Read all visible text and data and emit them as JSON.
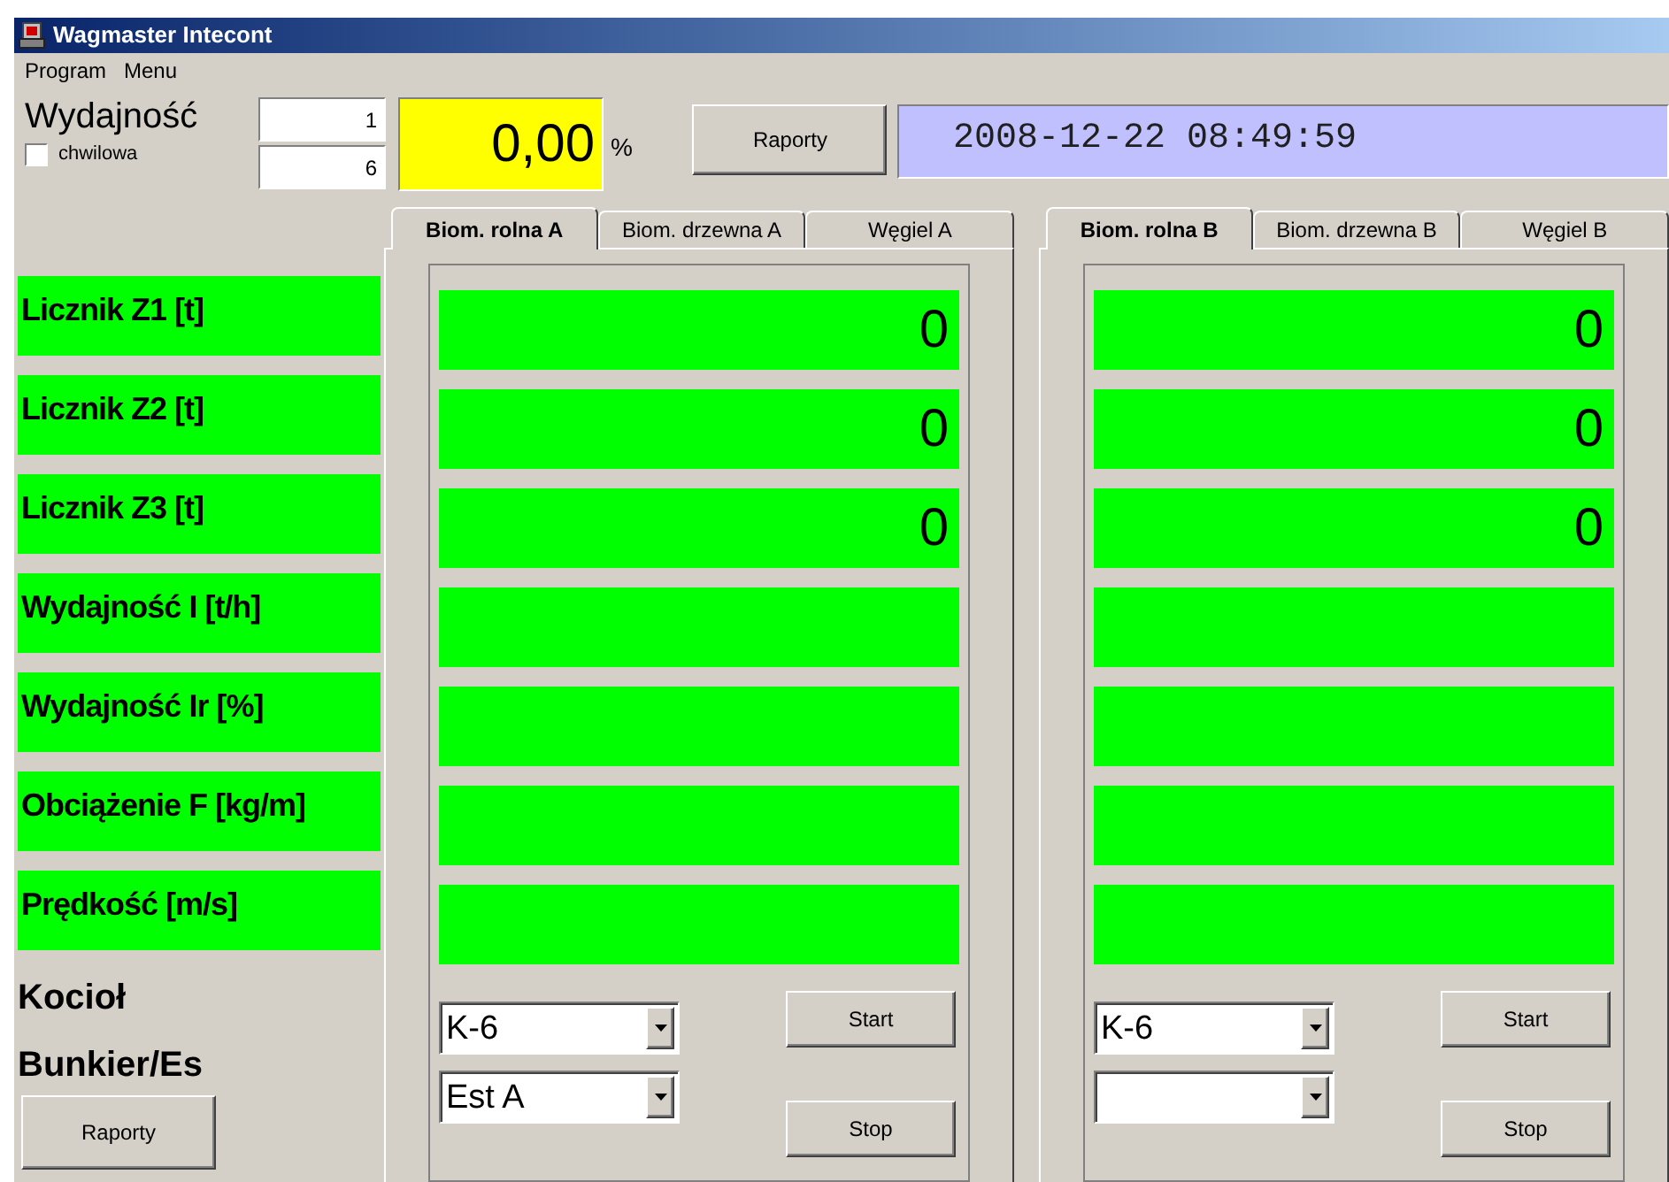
{
  "window": {
    "title": "Wagmaster Intecont"
  },
  "menu": [
    "Program",
    "Menu"
  ],
  "header": {
    "label": "Wydajność",
    "checkbox": {
      "label": "chwilowa",
      "checked": false
    },
    "fields": [
      "1",
      "6"
    ],
    "percent": "0,00",
    "unit": "%",
    "button": "Raporty",
    "datetime": "2008-12-22 08:49:59"
  },
  "rows": [
    "Licznik Z1 [t]",
    "Licznik Z2 [t]",
    "Licznik Z3 [t]",
    "Wydajność I [t/h]",
    "Wydajność Ir [%]",
    "Obciążenie F [kg/m]",
    "Prędkość [m/s]"
  ],
  "footer": {
    "kociol": "Kocioł",
    "bunkier": "Bunkier/Es",
    "button": "Raporty"
  },
  "panels": [
    {
      "tabs": [
        {
          "label": "Biom. rolna A",
          "selected": true
        },
        {
          "label": "Biom. drzewna A",
          "selected": false
        },
        {
          "label": "Węgiel A",
          "selected": false
        }
      ],
      "values": [
        "0",
        "0",
        "0"
      ],
      "kociol": "K-6",
      "bunkier": "Est A",
      "start": "Start",
      "stop": "Stop"
    },
    {
      "tabs": [
        {
          "label": "Biom. rolna B",
          "selected": true
        },
        {
          "label": "Biom. drzewna B",
          "selected": false
        },
        {
          "label": "Węgiel B",
          "selected": false
        }
      ],
      "values": [
        "0",
        "0",
        "0"
      ],
      "kociol": "K-6",
      "start": "Start",
      "stop": "Stop"
    }
  ]
}
